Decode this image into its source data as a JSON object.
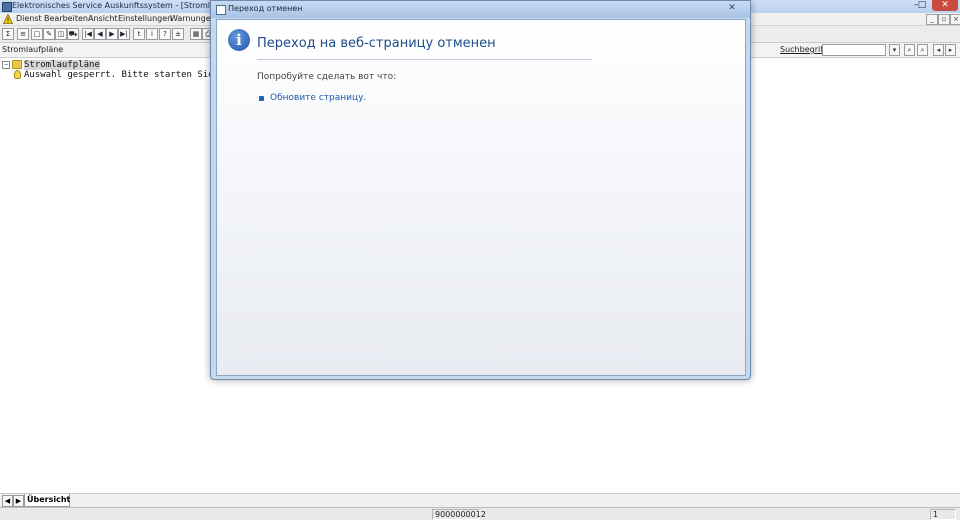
{
  "app": {
    "title": "Elektronisches Service Auskunftssystem - [Stromlaufpläne]",
    "window_buttons": [
      "–",
      "□",
      "✕"
    ]
  },
  "menu": {
    "items": [
      "Dienst",
      "Bearbeiten",
      "Ansicht",
      "Einstellungen",
      "Warnungen"
    ],
    "mdi_buttons": [
      "_",
      "▫",
      "×"
    ]
  },
  "toolbar": {
    "buttons": [
      "Σ",
      "≡",
      "□",
      "✎",
      "◫",
      "⛟",
      "|◀",
      "◀",
      "▶",
      "▶|",
      "t",
      "i",
      "?",
      "±",
      "▦",
      "⎙"
    ]
  },
  "strip": {
    "left_label": "Stromlaufpläne",
    "search_label": "Suchbegriff:",
    "search_value": "",
    "buttons": [
      "▾",
      "⌕",
      "⌕",
      "◂",
      "▸"
    ]
  },
  "tree": {
    "root": {
      "expander": "−",
      "label": "Stromlaufpläne"
    },
    "child": {
      "label": "Auswahl gesperrt. Bitte starten Sie"
    }
  },
  "tabs": {
    "nav": [
      "◀",
      "▶"
    ],
    "active": "Übersicht"
  },
  "status": {
    "code": "9000000012",
    "page": "1"
  },
  "dialog": {
    "title": "Переход отменен",
    "close_symbol": "✕",
    "heading": "Переход на веб-страницу отменен",
    "try_text": "Попробуйте сделать вот что:",
    "refresh_link": "Обновите страницу."
  }
}
